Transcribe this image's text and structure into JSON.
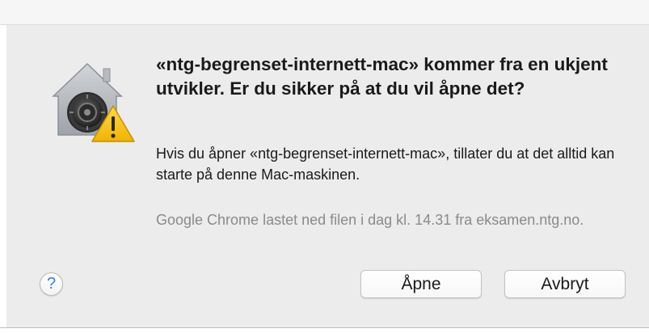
{
  "dialog": {
    "title": "«ntg-begrenset-internett-mac» kommer fra en ukjent utvikler. Er du sikker på at du vil åpne det?",
    "message": "Hvis du åpner «ntg-begrenset-internett-mac», tillater du at det alltid kan starte på denne Mac-maskinen.",
    "source": "Google Chrome lastet ned filen i dag kl. 14.31 fra eksamen.ntg.no.",
    "icon": "gatekeeper-warning-icon"
  },
  "buttons": {
    "help_label": "?",
    "open_label": "Åpne",
    "cancel_label": "Avbryt"
  },
  "colors": {
    "dialog_background": "#ececec",
    "help_accent": "#2f7cf6",
    "secondary_text": "#8a8a8a",
    "warning_yellow": "#f5c518"
  }
}
